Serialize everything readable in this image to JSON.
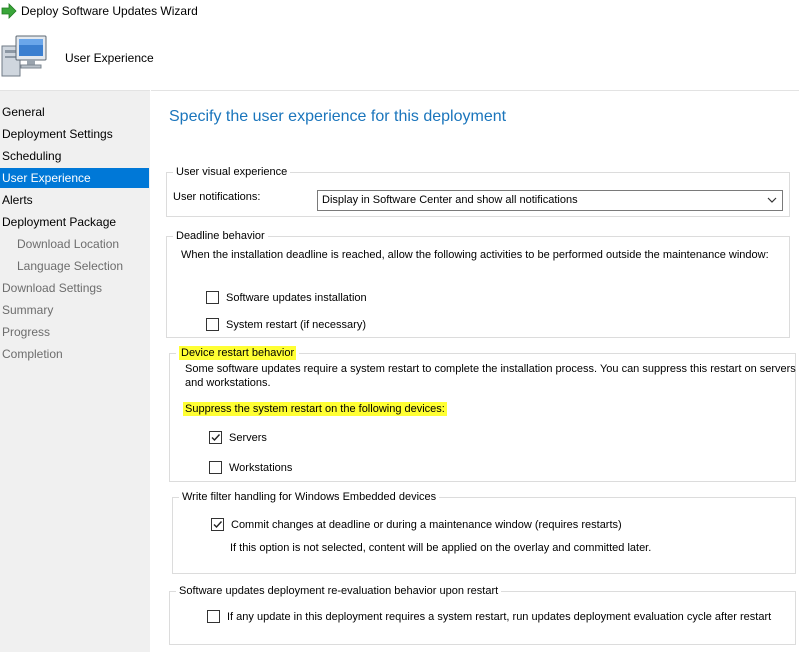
{
  "window": {
    "title": "Deploy Software Updates Wizard"
  },
  "header": {
    "title": "User Experience"
  },
  "sidebar": {
    "items": [
      {
        "label": "General"
      },
      {
        "label": "Deployment Settings"
      },
      {
        "label": "Scheduling"
      },
      {
        "label": "User Experience"
      },
      {
        "label": "Alerts"
      },
      {
        "label": "Deployment Package"
      },
      {
        "label": "Download Location"
      },
      {
        "label": "Language Selection"
      },
      {
        "label": "Download Settings"
      },
      {
        "label": "Summary"
      },
      {
        "label": "Progress"
      },
      {
        "label": "Completion"
      }
    ]
  },
  "main": {
    "heading": "Specify the user experience for this deployment",
    "visual": {
      "legend": "User visual experience",
      "notifications_label": "User notifications:",
      "notifications_value": "Display in Software Center and show all notifications"
    },
    "deadline": {
      "legend": "Deadline behavior",
      "description": "When the installation deadline is reached, allow the following activities to be performed outside the maintenance window:",
      "software_updates_label": "Software updates installation",
      "software_updates_checked": false,
      "system_restart_label": "System restart (if necessary)",
      "system_restart_checked": false
    },
    "restart": {
      "legend": "Device restart behavior",
      "description_line1": "Some software updates require a system restart to complete the installation process. You can suppress this restart on servers",
      "description_line2": "and workstations.",
      "suppress_label": "Suppress the system restart on the following devices:",
      "servers_label": "Servers",
      "servers_checked": true,
      "workstations_label": "Workstations",
      "workstations_checked": false
    },
    "write_filter": {
      "legend": "Write filter handling for Windows Embedded devices",
      "commit_label": "Commit changes at deadline or during a maintenance window (requires restarts)",
      "commit_checked": true,
      "note": "If this option is not selected, content will be applied on the overlay and committed later."
    },
    "reevaluation": {
      "legend": "Software updates deployment re-evaluation behavior upon restart",
      "label": "If any update in this deployment requires a system restart, run updates deployment evaluation cycle after restart",
      "checked": false
    }
  },
  "colors": {
    "accent": "#0078d7",
    "heading": "#1a75bc",
    "highlight": "#ffff33"
  }
}
